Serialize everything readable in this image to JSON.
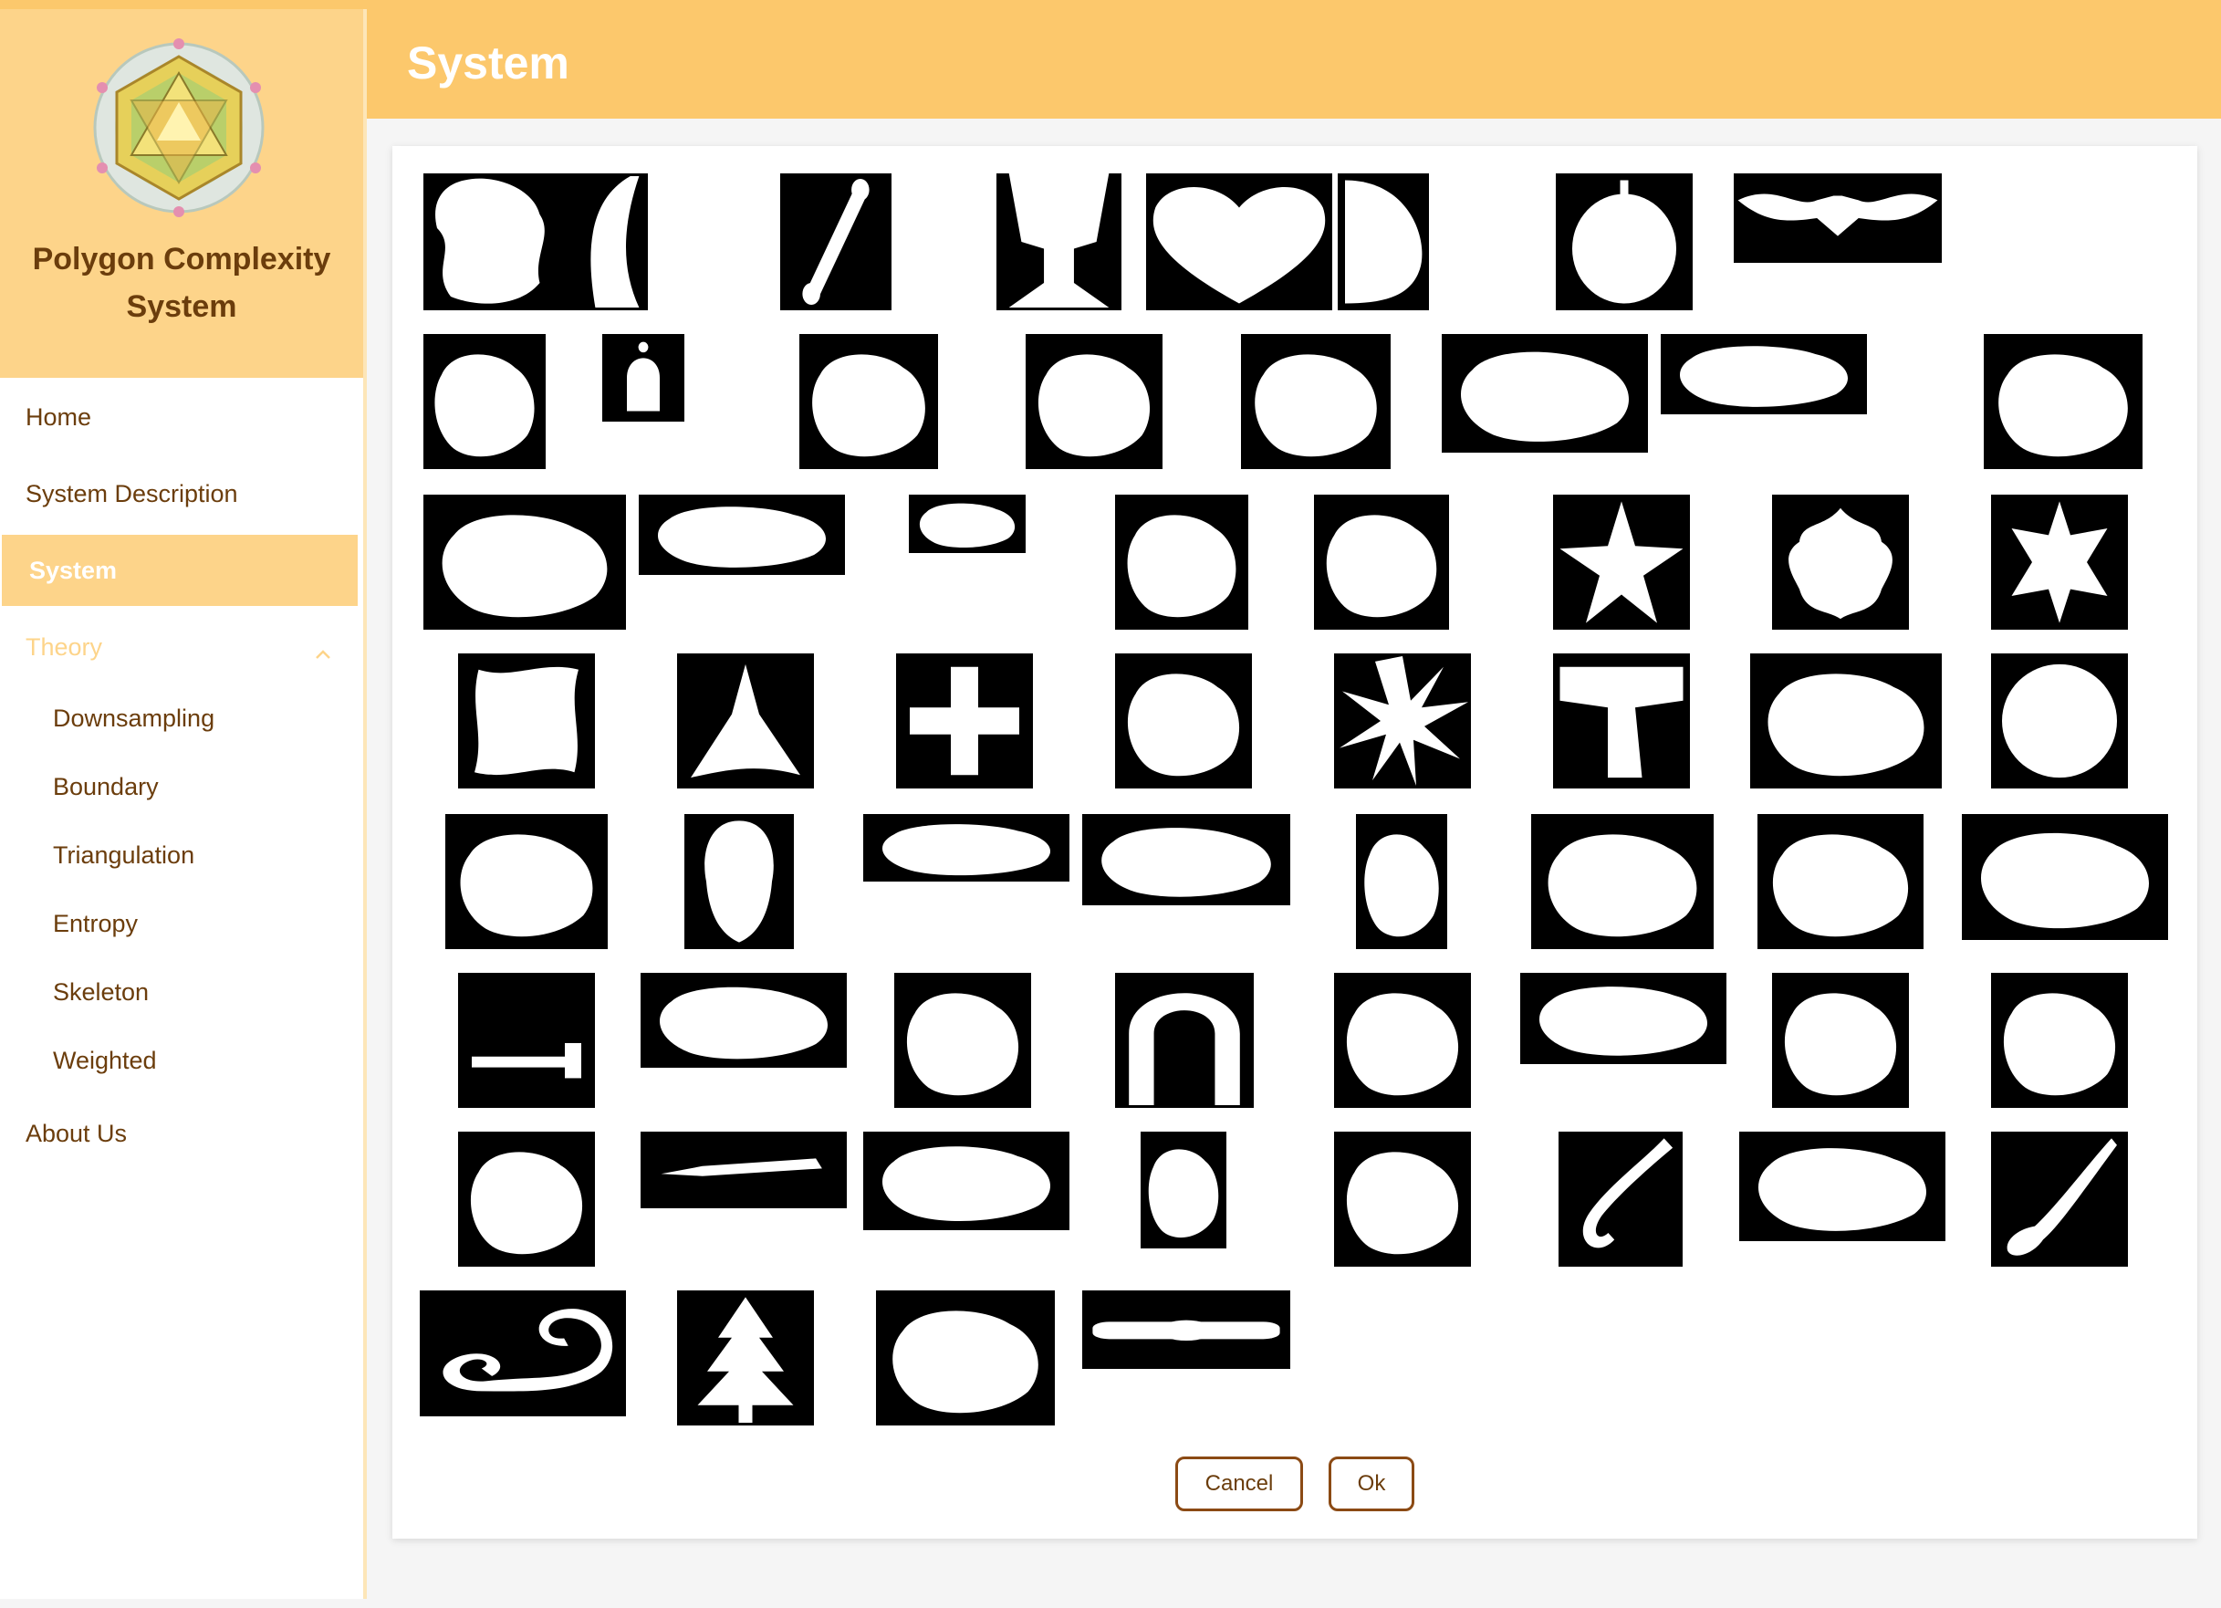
{
  "app": {
    "title": "Polygon Complexity System",
    "title_line1": "Polygon Complexity",
    "title_line2": "System",
    "logo_icon": "polygon-mandala-logo-icon"
  },
  "colors": {
    "accent": "#fcc86c",
    "sidebar_header": "#fdd48a",
    "text": "#6b3d0c",
    "button_border": "#8b4a14"
  },
  "sidebar": {
    "items": [
      {
        "label": "Home"
      },
      {
        "label": "System Description"
      },
      {
        "label": "System",
        "active": true
      },
      {
        "label": "Theory",
        "expanded": true,
        "icon": "chevron-up-icon"
      },
      {
        "label": "About Us"
      }
    ],
    "theory_subitems": [
      {
        "label": "Downsampling"
      },
      {
        "label": "Boundary"
      },
      {
        "label": "Triangulation"
      },
      {
        "label": "Entropy"
      },
      {
        "label": "Skeleton"
      },
      {
        "label": "Weighted"
      }
    ]
  },
  "header": {
    "title": "System"
  },
  "gallery": {
    "shapes": [
      "blob",
      "leaf",
      "bone",
      "cup",
      "heart",
      "semicircle",
      "apple",
      "bat",
      "beetle",
      "bell",
      "bird",
      "butterfly",
      "camel",
      "cattle",
      "rectangle",
      "chicken",
      "child",
      "car",
      "crown",
      "mug",
      "deer",
      "star-flower",
      "flower",
      "seven-star",
      "square-blob",
      "triangle-blob",
      "cross-blob",
      "pentagon-star",
      "sun-star",
      "t-shape",
      "dog",
      "moon-circle",
      "elephant",
      "head",
      "fish",
      "fish-oval",
      "fly",
      "fork",
      "frog",
      "guitar",
      "hammer",
      "hat",
      "horse",
      "horseshoe",
      "jar",
      "key-blob",
      "lizard",
      "feather",
      "octopus",
      "pencil",
      "sedan",
      "pocket-watch",
      "rat",
      "hook",
      "shoe",
      "spoon",
      "spiral",
      "tree",
      "turtle",
      "watch"
    ]
  },
  "actions": {
    "cancel_label": "Cancel",
    "ok_label": "Ok"
  }
}
